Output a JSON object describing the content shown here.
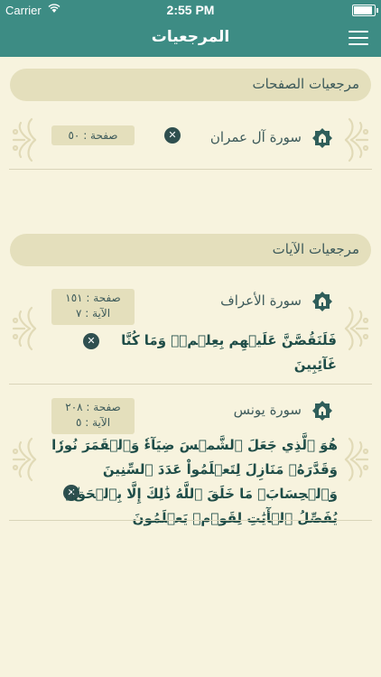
{
  "status_bar": {
    "carrier": "Carrier",
    "time": "2:55 PM"
  },
  "nav": {
    "title": "المرجعيات",
    "menu_icon": "hamburger-menu-icon"
  },
  "pages_section": {
    "title": "مرجعيات الصفحات",
    "items": [
      {
        "sura": "سورة آل عمران",
        "page": "صفحة : ٥٠"
      }
    ]
  },
  "ayat_section": {
    "title": "مرجعيات الآيات",
    "items": [
      {
        "sura": "سورة الأعراف",
        "page": "صفحة : ١٥١",
        "ayah_no": "الآية : ٧",
        "text": "فَلَنَقُصَّنَّ عَلَيۡهِم بِعِلۡمٖۖ وَمَا كُنَّا غَآئِبِينَ"
      },
      {
        "sura": "سورة يونس",
        "page": "صفحة : ٢٠٨",
        "ayah_no": "الآية : ٥",
        "text": "هُوَ ٱلَّذِي جَعَلَ ٱلشَّمۡسَ ضِيَآءٗ وَٱلۡقَمَرَ نُورٗا وَقَدَّرَهُۥ مَنَازِلَ لِتَعۡلَمُواْ عَدَدَ ٱلسِّنِينَ وَٱلۡحِسَابَۚ مَا خَلَقَ ٱللَّهُ ذَٰلِكَ إِلَّا بِٱلۡحَقِّۚ يُفَصِّلُ ٱلۡأٓيَٰتِ لِقَوۡمٖ يَعۡلَمُونَ"
      }
    ]
  },
  "colors": {
    "navbar": "#3d8c84",
    "background": "#f7f3de",
    "pill": "#e4dfbc",
    "text": "#3d5a5a"
  }
}
